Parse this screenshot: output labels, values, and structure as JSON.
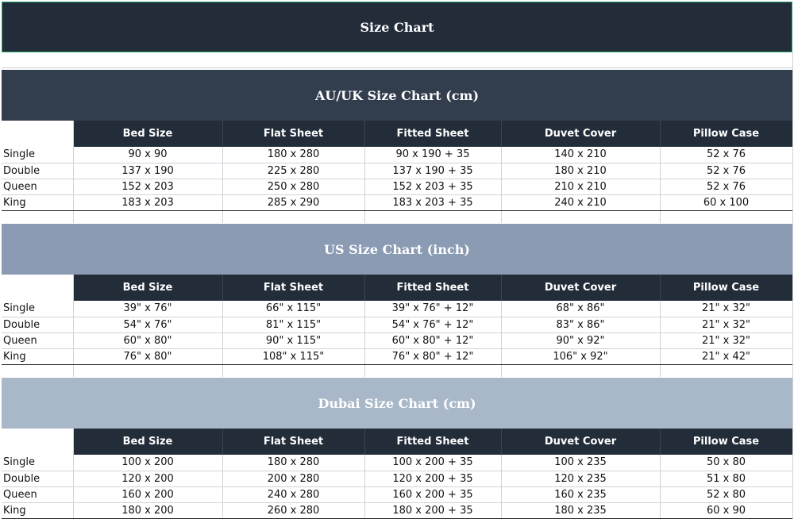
{
  "colors": {
    "dark": "#232d3a",
    "au_uk_title_bg": "#323d4d",
    "us_title_bg": "#8a9bb3",
    "dubai_title_bg": "#a9b8c9"
  },
  "page_title": "Size Chart",
  "sections": [
    {
      "title": "AU/UK Size Chart (cm)",
      "headers": [
        "Bed Size",
        "Flat Sheet",
        "Fitted Sheet",
        "Duvet Cover",
        "Pillow Case"
      ],
      "rows": [
        [
          "Single",
          "90 x 90",
          "180 x 280",
          "90 x 190 + 35",
          "140 x 210",
          "52 x 76"
        ],
        [
          "Double",
          "137 x 190",
          "225 x 280",
          "137 x 190 + 35",
          "180 x 210",
          "52 x 76"
        ],
        [
          "Queen",
          "152 x 203",
          "250 x 280",
          "152 x 203 + 35",
          "210 x 210",
          "52 x 76"
        ],
        [
          "King",
          "183 x 203",
          "285 x 290",
          "183 x 203 + 35",
          "240 x 210",
          "60 x 100"
        ]
      ]
    },
    {
      "title": "US Size Chart (inch)",
      "headers": [
        "Bed Size",
        "Flat Sheet",
        "Fitted Sheet",
        "Duvet Cover",
        "Pillow Case"
      ],
      "rows": [
        [
          "Single",
          "39\" x 76\"",
          "66\" x 115\"",
          "39\" x 76\" + 12\"",
          "68\" x 86\"",
          "21\" x 32\""
        ],
        [
          "Double",
          "54\" x 76\"",
          "81\" x 115\"",
          "54\" x 76\" + 12\"",
          "83\" x 86\"",
          "21\" x 32\""
        ],
        [
          "Queen",
          "60\" x 80\"",
          "90\" x 115\"",
          "60\" x 80\" + 12\"",
          "90\" x 92\"",
          "21\" x 32\""
        ],
        [
          "King",
          "76\" x 80\"",
          "108\" x 115\"",
          "76\" x 80\" + 12\"",
          "106\" x 92\"",
          "21\" x 42\""
        ]
      ]
    },
    {
      "title": "Dubai Size Chart (cm)",
      "headers": [
        "Bed Size",
        "Flat Sheet",
        "Fitted Sheet",
        "Duvet Cover",
        "Pillow Case"
      ],
      "rows": [
        [
          "Single",
          "100 x 200",
          "180 x 280",
          "100 x 200 + 35",
          "100 x 235",
          "50 x 80"
        ],
        [
          "Double",
          "120 x 200",
          "200 x 280",
          "120 x 200 + 35",
          "120 x 235",
          "51 x 80"
        ],
        [
          "Queen",
          "160 x 200",
          "240 x 280",
          "160 x 200 + 35",
          "160 x 235",
          "52 x 80"
        ],
        [
          "King",
          "180 x 200",
          "260 x 280",
          "180 x 200 + 35",
          "180 x 235",
          "60 x 90"
        ]
      ]
    }
  ]
}
